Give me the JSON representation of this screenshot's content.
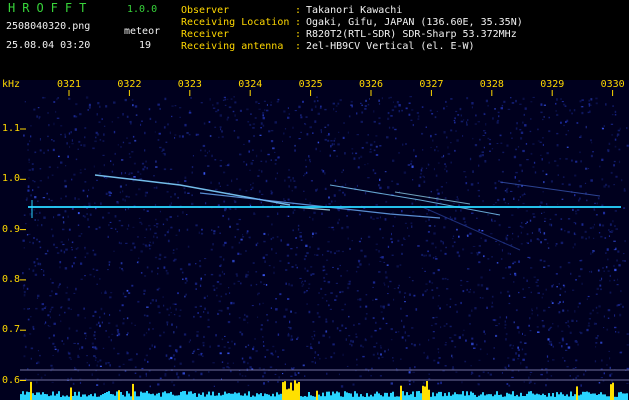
{
  "header": {
    "app_title": "HROFFT",
    "app_version": "1.0.0",
    "file_name": "2508040320.png",
    "meteor_label": "meteor",
    "timestamp": "25.08.04 03:20",
    "meteor_count": "19"
  },
  "station_info": [
    {
      "key": "Observer",
      "value": "Takanori Kawachi"
    },
    {
      "key": "Receiving Location",
      "value": "Ogaki, Gifu, JAPAN (136.60E, 35.35N)"
    },
    {
      "key": "Receiver",
      "value": "R820T2(RTL-SDR) SDR-Sharp 53.372MHz"
    },
    {
      "key": "Receiving antenna",
      "value": "2el-HB9CV Vertical (el. E-W)"
    }
  ],
  "separator": ":",
  "spectrogram": {
    "freq_unit": "kHz",
    "time_ticks": [
      "0321",
      "0322",
      "0323",
      "0324",
      "0325",
      "0326",
      "0327",
      "0328",
      "0329",
      "0330"
    ],
    "freq_ticks": [
      "1.1",
      "1.0",
      "0.9",
      "0.8",
      "0.7",
      "0.6"
    ],
    "colors": {
      "background": "#00001e",
      "noise": "#1a2a9a",
      "signal": "#7fd0ff",
      "baseline": "#29d4ff",
      "burst": "#ffe000",
      "guide": "#7070a0"
    }
  }
}
